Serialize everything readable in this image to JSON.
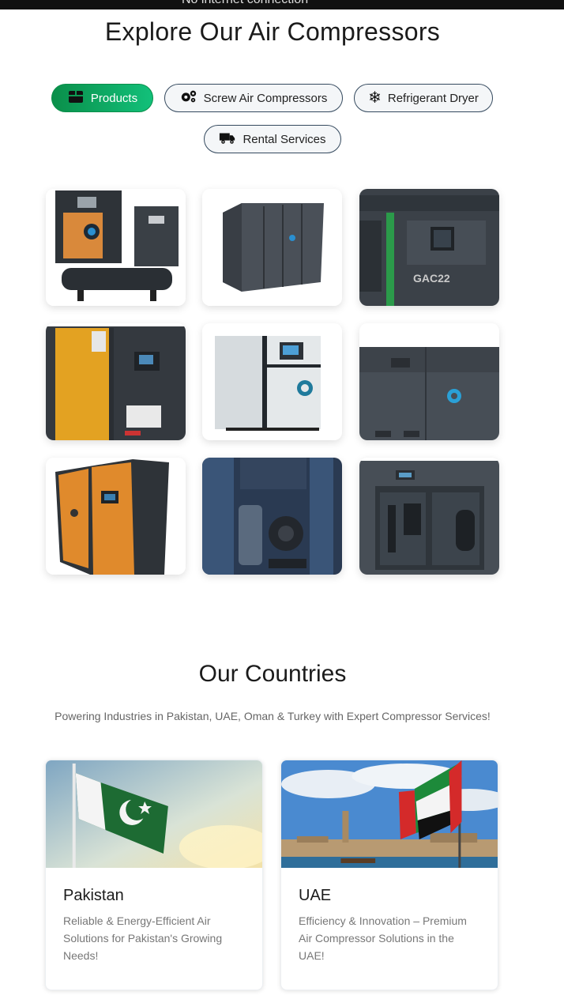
{
  "status_bar": {
    "text": "No internet connection"
  },
  "explore": {
    "title": "Explore Our Air Compressors",
    "filters": [
      {
        "label": "Products",
        "icon": "box-icon",
        "active": true
      },
      {
        "label": "Screw Air Compressors",
        "icon": "gears-icon",
        "active": false
      },
      {
        "label": "Refrigerant Dryer",
        "icon": "snowflake-icon",
        "active": false
      },
      {
        "label": "Rental Services",
        "icon": "truck-icon",
        "active": false
      }
    ],
    "products": [
      {
        "image": "orange-compressor-on-tank",
        "label": ""
      },
      {
        "image": "gray-enclosed-compressor",
        "label": ""
      },
      {
        "image": "gac22-compressor-panel",
        "label": "GAC22"
      },
      {
        "image": "yellow-compressor",
        "label": ""
      },
      {
        "image": "white-compressor",
        "label": ""
      },
      {
        "image": "gray-large-compressor",
        "label": ""
      },
      {
        "image": "orange-compressor-side",
        "label": ""
      },
      {
        "image": "compressor-interior",
        "label": ""
      },
      {
        "image": "compressor-open-doors",
        "label": ""
      }
    ]
  },
  "countries": {
    "title": "Our Countries",
    "subtitle": "Powering Industries in Pakistan, UAE, Oman & Turkey with Expert Compressor Services!",
    "items": [
      {
        "name": "Pakistan",
        "description": "Reliable & Energy-Efficient Air Solutions for Pakistan's Growing Needs!",
        "image": "pakistan-flag"
      },
      {
        "name": "UAE",
        "description": "Efficiency & Innovation – Premium Air Compressor Solutions in the UAE!",
        "image": "uae-flag"
      }
    ]
  },
  "colors": {
    "accent": "#0a8f4a",
    "pill_border": "#34495e",
    "text": "#1b1b1b",
    "muted": "#777777"
  }
}
